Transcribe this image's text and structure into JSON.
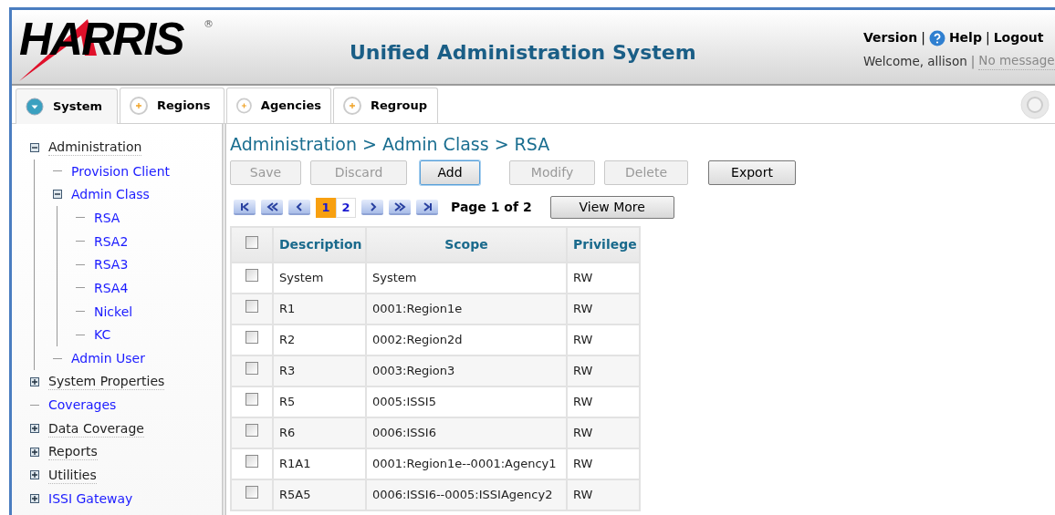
{
  "header": {
    "logo": "HARRIS",
    "logo_mark": "®",
    "title": "Unified Administration System",
    "links": [
      "Version",
      "Help",
      "Logout"
    ],
    "welcome": "Welcome, allison",
    "messages": "No message",
    "separators": [
      "|",
      "|",
      "|"
    ]
  },
  "tabs": [
    {
      "label": "System",
      "selected": true
    },
    {
      "label": "Regions",
      "selected": false
    },
    {
      "label": "Agencies",
      "selected": false
    },
    {
      "label": "Regroup",
      "selected": false
    }
  ],
  "tree": [
    {
      "label": "Administration",
      "kind": "plain",
      "expanded": true,
      "children": [
        {
          "label": "Provision Client",
          "kind": "link"
        },
        {
          "label": "Admin Class",
          "kind": "link",
          "expanded": true,
          "children": [
            {
              "label": "RSA",
              "kind": "link"
            },
            {
              "label": "RSA2",
              "kind": "link"
            },
            {
              "label": "RSA3",
              "kind": "link"
            },
            {
              "label": "RSA4",
              "kind": "link"
            },
            {
              "label": "Nickel",
              "kind": "link"
            },
            {
              "label": "KC",
              "kind": "link"
            }
          ]
        },
        {
          "label": "Admin User",
          "kind": "link"
        }
      ]
    },
    {
      "label": "System Properties",
      "kind": "plain",
      "expanded": false
    },
    {
      "label": "Coverages",
      "kind": "link"
    },
    {
      "label": "Data Coverage",
      "kind": "plain",
      "expanded": false
    },
    {
      "label": "Reports",
      "kind": "plain",
      "expanded": false
    },
    {
      "label": "Utilities",
      "kind": "plain",
      "expanded": false
    },
    {
      "label": "ISSI Gateway",
      "kind": "link",
      "expanded": false
    }
  ],
  "breadcrumb": "Administration > Admin Class > RSA",
  "buttons": [
    {
      "label": "Save",
      "disabled": true,
      "focused": false
    },
    {
      "label": "Discard",
      "disabled": true,
      "focused": false
    },
    {
      "label": "Add",
      "disabled": false,
      "focused": true
    },
    {
      "label": "Modify",
      "disabled": true,
      "focused": false
    },
    {
      "label": "Delete",
      "disabled": true,
      "focused": false
    },
    {
      "label": "Export",
      "disabled": false,
      "focused": false
    }
  ],
  "pager": {
    "pages": [
      {
        "label": "1",
        "selected": true
      },
      {
        "label": "2",
        "selected": false
      }
    ],
    "status": "Page 1 of 2",
    "view_more": "View More"
  },
  "table": {
    "header_checked": false,
    "columns": [
      "Description",
      "Scope",
      "Privilege"
    ],
    "rows": [
      {
        "checked": false,
        "cells": [
          "System",
          "System",
          "RW"
        ]
      },
      {
        "checked": false,
        "cells": [
          "R1",
          "0001:Region1e",
          "RW"
        ]
      },
      {
        "checked": false,
        "cells": [
          "R2",
          "0002:Region2d",
          "RW"
        ]
      },
      {
        "checked": false,
        "cells": [
          "R3",
          "0003:Region3",
          "RW"
        ]
      },
      {
        "checked": false,
        "cells": [
          "R5",
          "0005:ISSI5",
          "RW"
        ]
      },
      {
        "checked": false,
        "cells": [
          "R6",
          "0006:ISSI6",
          "RW"
        ]
      },
      {
        "checked": false,
        "cells": [
          "R1A1",
          "0001:Region1e--0001:Agency1",
          "RW"
        ]
      },
      {
        "checked": false,
        "cells": [
          "R5A5",
          "0006:ISSI6--0005:ISSIAgency2",
          "RW"
        ]
      }
    ]
  }
}
